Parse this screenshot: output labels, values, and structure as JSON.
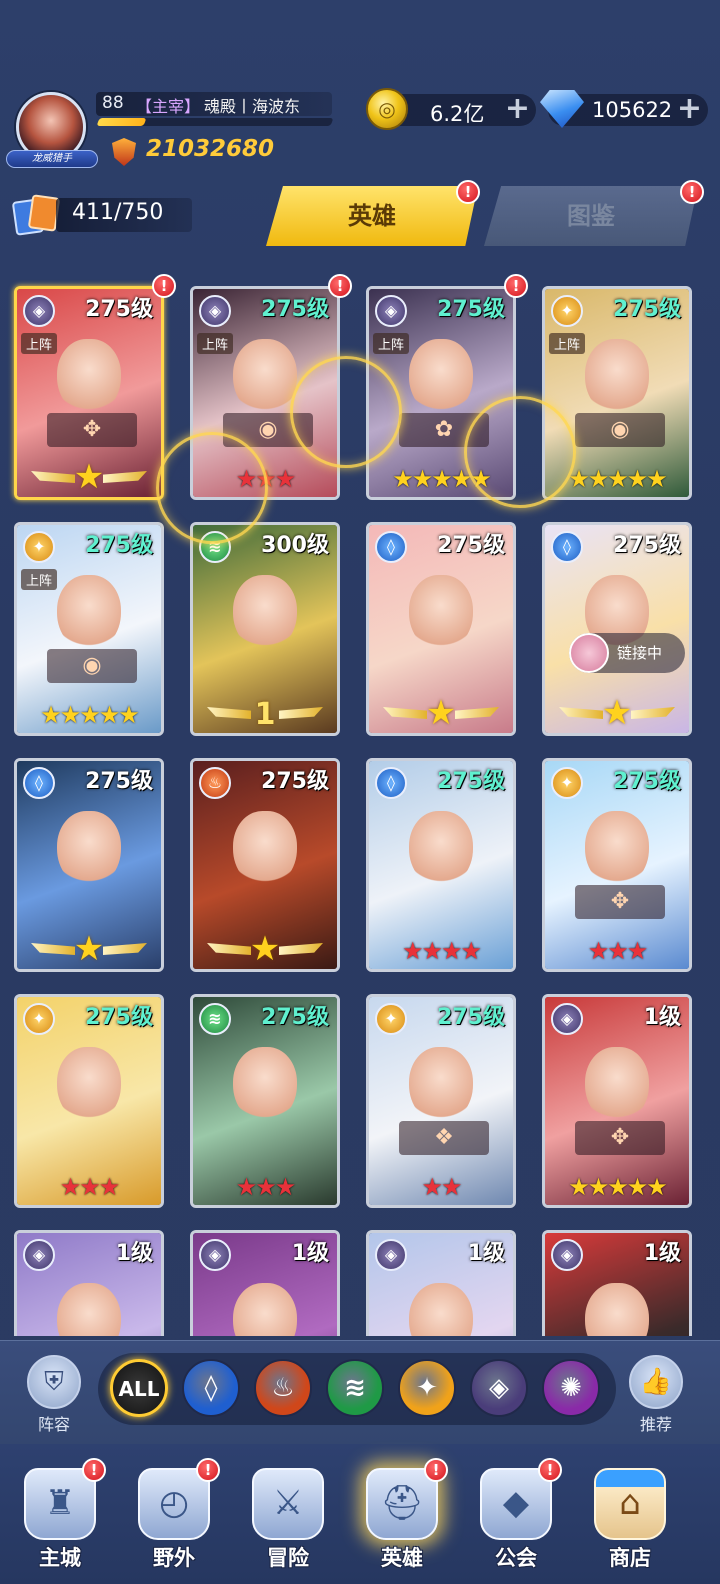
{
  "player": {
    "level": "88",
    "role_tag": "【主宰】",
    "name": "魂殿丨海波东",
    "title_badge": "龙威猎手",
    "power": "21032680",
    "exp_fraction": 0.2
  },
  "resources": {
    "gold": "6.2亿",
    "gems": "105622",
    "plus": "+"
  },
  "collection": {
    "count": "411/750"
  },
  "tabs": [
    {
      "label": "英雄",
      "active": true,
      "badge": "!"
    },
    {
      "label": "图鉴",
      "active": false,
      "badge": "!"
    }
  ],
  "heroes": [
    {
      "level": "275级",
      "level_color": "white",
      "faction": "dark",
      "on_team": "上阵",
      "stars": "★",
      "star_style": "wing",
      "badge": "!",
      "selected": true,
      "emblem": "✥"
    },
    {
      "level": "275级",
      "level_color": "teal",
      "faction": "dark",
      "on_team": "上阵",
      "stars": "★★★",
      "star_style": "red",
      "badge": "!",
      "emblem": "◉"
    },
    {
      "level": "275级",
      "level_color": "teal",
      "faction": "dark",
      "on_team": "上阵",
      "stars": "★★★★★",
      "star_style": "gold",
      "badge": "!",
      "emblem": "✿"
    },
    {
      "level": "275级",
      "level_color": "teal",
      "faction": "light",
      "on_team": "上阵",
      "stars": "★★★★★",
      "star_style": "gold",
      "emblem": "◉"
    },
    {
      "level": "275级",
      "level_color": "teal",
      "faction": "light",
      "on_team": "上阵",
      "stars": "★★★★★",
      "star_style": "gold",
      "emblem": "◉"
    },
    {
      "level": "300级",
      "level_color": "white",
      "faction": "wind",
      "stars": "1",
      "star_style": "wing-num"
    },
    {
      "level": "275级",
      "level_color": "white",
      "faction": "water",
      "stars": "★",
      "star_style": "wing"
    },
    {
      "level": "275级",
      "level_color": "white",
      "faction": "water",
      "stars": "★",
      "star_style": "wing",
      "link": "链接中"
    },
    {
      "level": "275级",
      "level_color": "white",
      "faction": "water",
      "stars": "★",
      "star_style": "wing"
    },
    {
      "level": "275级",
      "level_color": "white",
      "faction": "fire",
      "stars": "★",
      "star_style": "wing"
    },
    {
      "level": "275级",
      "level_color": "teal",
      "faction": "water",
      "stars": "★★★★",
      "star_style": "red"
    },
    {
      "level": "275级",
      "level_color": "teal",
      "faction": "light",
      "stars": "★★★",
      "star_style": "red",
      "emblem": "✥"
    },
    {
      "level": "275级",
      "level_color": "teal",
      "faction": "light",
      "stars": "★★★",
      "star_style": "red"
    },
    {
      "level": "275级",
      "level_color": "teal",
      "faction": "wind",
      "stars": "★★★",
      "star_style": "red"
    },
    {
      "level": "275级",
      "level_color": "teal",
      "faction": "light",
      "stars": "★★",
      "star_style": "red",
      "emblem": "❖"
    },
    {
      "level": "1级",
      "level_color": "white",
      "faction": "dark",
      "stars": "★★★★★",
      "star_style": "gold",
      "emblem": "✥"
    },
    {
      "level": "1级",
      "level_color": "white",
      "faction": "dark",
      "stars": "",
      "star_style": "none"
    },
    {
      "level": "1级",
      "level_color": "white",
      "faction": "dark",
      "stars": "",
      "star_style": "none"
    },
    {
      "level": "1级",
      "level_color": "white",
      "faction": "dark",
      "stars": "",
      "star_style": "none"
    },
    {
      "level": "1级",
      "level_color": "white",
      "faction": "dark",
      "stars": "",
      "star_style": "none"
    }
  ],
  "filter_bar": {
    "left_label": "阵容",
    "right_label": "推荐",
    "filters": [
      {
        "label": "ALL",
        "icon": "all-icon",
        "color": "#111111"
      },
      {
        "label": "",
        "icon": "water-faction-icon",
        "color": "#1f5fd0"
      },
      {
        "label": "",
        "icon": "fire-faction-icon",
        "color": "#d0471a"
      },
      {
        "label": "",
        "icon": "wind-faction-icon",
        "color": "#1f9a46"
      },
      {
        "label": "",
        "icon": "light-faction-icon",
        "color": "#f0a21a"
      },
      {
        "label": "",
        "icon": "dark-faction-icon",
        "color": "#4a3d7a"
      },
      {
        "label": "",
        "icon": "chaos-faction-icon",
        "color": "#8a2aa8"
      }
    ]
  },
  "bottom_nav": [
    {
      "label": "主城",
      "icon": "castle-icon",
      "badge": "!"
    },
    {
      "label": "野外",
      "icon": "wilderness-icon",
      "badge": "!"
    },
    {
      "label": "冒险",
      "icon": "adventure-icon",
      "badge": ""
    },
    {
      "label": "英雄",
      "icon": "hero-icon",
      "badge": "!",
      "active": true
    },
    {
      "label": "公会",
      "icon": "guild-icon",
      "badge": "!"
    },
    {
      "label": "商店",
      "icon": "shop-icon",
      "badge": ""
    }
  ]
}
